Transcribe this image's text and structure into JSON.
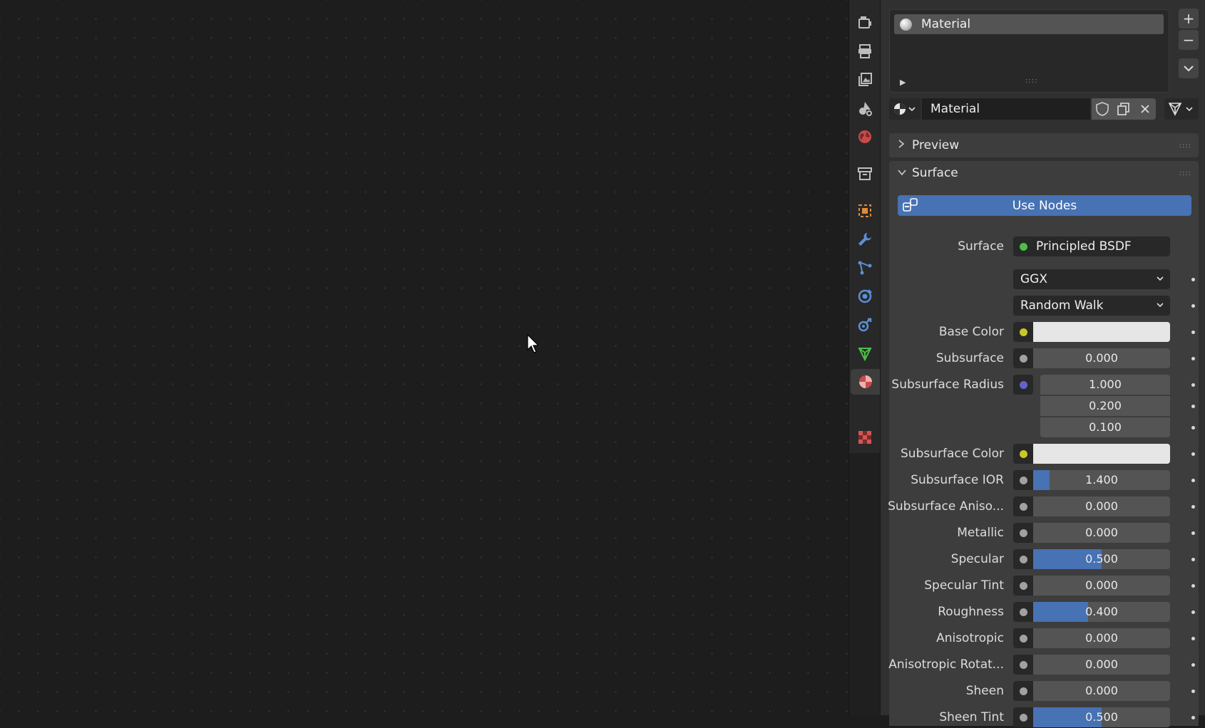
{
  "material_slots": {
    "items": [
      {
        "name": "Material"
      }
    ],
    "grip": "::::"
  },
  "material_selector": {
    "name": "Material"
  },
  "sections": {
    "preview": {
      "title": "Preview"
    },
    "surface": {
      "title": "Surface"
    }
  },
  "use_nodes_label": "Use Nodes",
  "surface_shader": {
    "label": "Surface",
    "value": "Principled BSDF"
  },
  "distribution": {
    "value": "GGX"
  },
  "subsurface_method": {
    "value": "Random Walk"
  },
  "properties": {
    "base_color": {
      "label": "Base Color",
      "color": "#e6e6e6"
    },
    "subsurface": {
      "label": "Subsurface",
      "value": "0.000"
    },
    "subsurface_radius": {
      "label": "Subsurface Radius",
      "values": [
        "1.000",
        "0.200",
        "0.100"
      ]
    },
    "subsurface_color": {
      "label": "Subsurface Color",
      "color": "#e6e6e6"
    },
    "subsurface_ior": {
      "label": "Subsurface IOR",
      "value": "1.400",
      "fill": 0.12
    },
    "subsurface_aniso": {
      "label": "Subsurface Aniso...",
      "value": "0.000"
    },
    "metallic": {
      "label": "Metallic",
      "value": "0.000"
    },
    "specular": {
      "label": "Specular",
      "value": "0.500",
      "fill": 0.5
    },
    "specular_tint": {
      "label": "Specular Tint",
      "value": "0.000"
    },
    "roughness": {
      "label": "Roughness",
      "value": "0.400",
      "fill": 0.4
    },
    "anisotropic": {
      "label": "Anisotropic",
      "value": "0.000"
    },
    "anisotropic_rotation": {
      "label": "Anisotropic Rotat...",
      "value": "0.000"
    },
    "sheen": {
      "label": "Sheen",
      "value": "0.000"
    },
    "sheen_tint": {
      "label": "Sheen Tint",
      "value": "0.500",
      "fill": 0.5
    }
  },
  "colors": {
    "accent": "#4772b3",
    "socket_color": "#c7c729",
    "socket_float": "#a1a1a1",
    "socket_vector": "#6363c7",
    "socket_shader": "#4bbf4b"
  },
  "icons": {
    "tabs": [
      "render-icon",
      "output-icon",
      "view-layer-icon",
      "scene-icon",
      "world-icon",
      "collection-icon",
      "object-icon",
      "modifier-icon",
      "particles-icon",
      "physics-icon",
      "constraints-icon",
      "object-data-icon",
      "material-icon",
      "texture-icon"
    ]
  }
}
